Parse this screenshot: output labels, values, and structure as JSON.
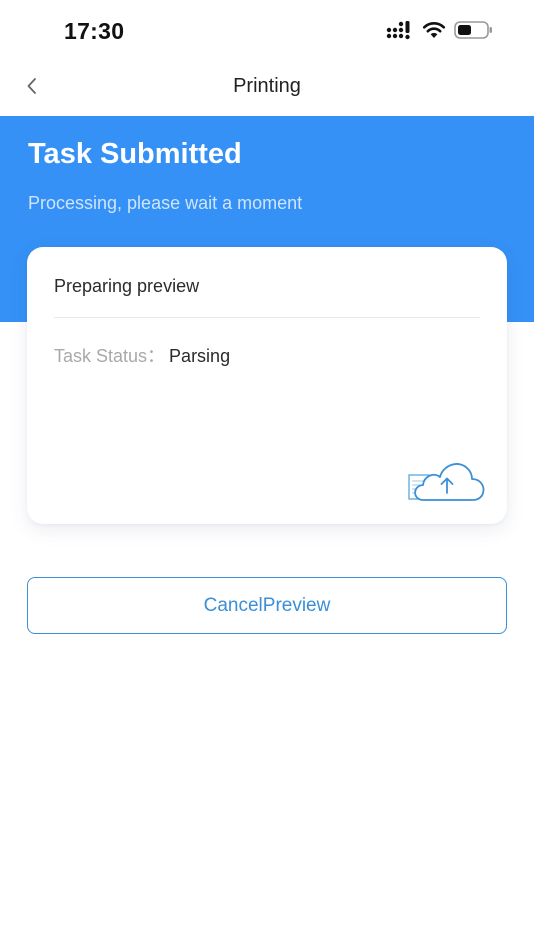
{
  "status_bar": {
    "time": "17:30"
  },
  "nav": {
    "title": "Printing",
    "back_icon": "chevron-left-icon"
  },
  "header": {
    "title": "Task Submitted",
    "subtitle": "Processing, please wait a moment"
  },
  "card": {
    "title": "Preparing preview",
    "status_label": "Task Status：",
    "status_value": "Parsing",
    "illustration_icon": "cloud-upload-icon"
  },
  "actions": {
    "cancel_label": "CancelPreview"
  },
  "colors": {
    "header_blue": "#3591f5",
    "button_blue": "#3a8fd6",
    "muted_text": "#a9a9a9"
  }
}
